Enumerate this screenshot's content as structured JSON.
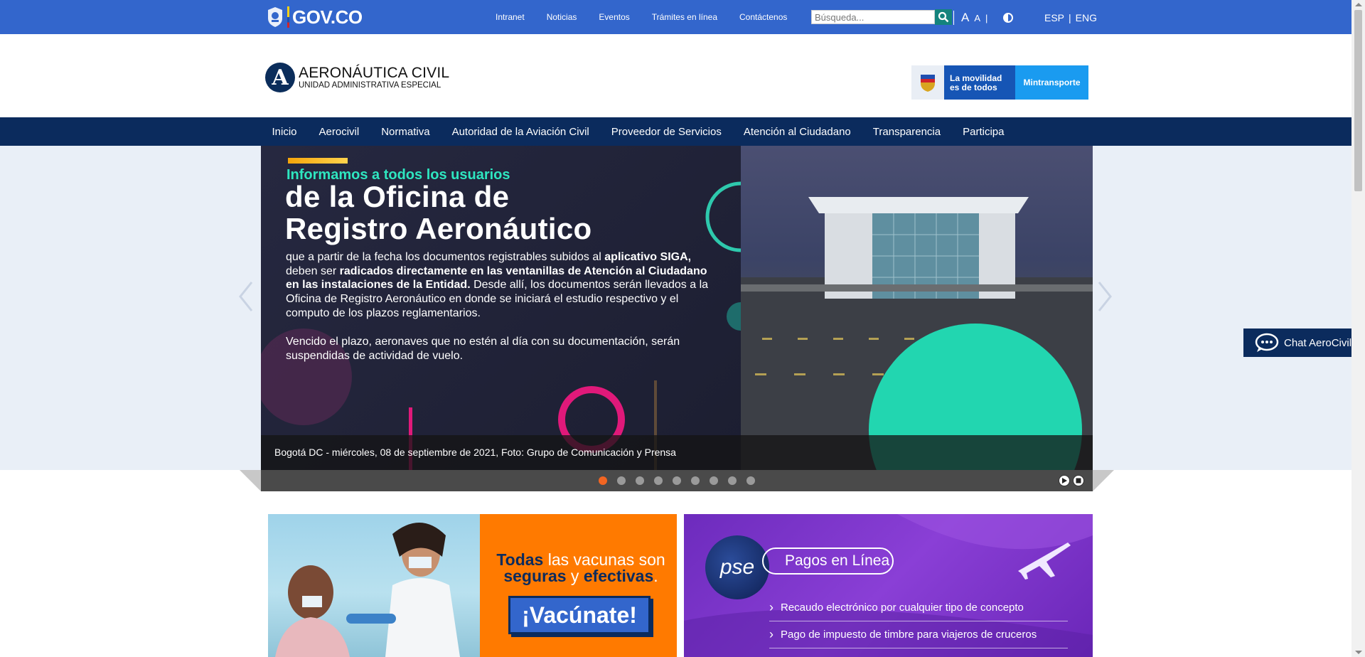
{
  "govbar": {
    "logo_text": "GOV.CO",
    "links": [
      "Intranet",
      "Noticias",
      "Eventos",
      "Trámites en línea",
      "Contáctenos"
    ],
    "search_placeholder": "Búsqueda...",
    "font_large": "A",
    "font_small": "A",
    "divider": "|",
    "lang_es": "ESP",
    "lang_sep": "|",
    "lang_en": "ENG"
  },
  "header": {
    "logo_letter": "A",
    "logo_line1": "AERONÁUTICA CIVIL",
    "logo_line2": "UNIDAD ADMINISTRATIVA ESPECIAL",
    "partner_line1": "La movilidad",
    "partner_line2": "es de todos",
    "partner_name": "Mintransporte"
  },
  "mainnav": {
    "items": [
      "Inicio",
      "Aerocivil",
      "Normativa",
      "Autoridad de la Aviación Civil",
      "Proveedor de Servicios",
      "Atención al Ciudadano",
      "Transparencia",
      "Participa"
    ]
  },
  "slider": {
    "kicker": "Informamos a todos los usuarios",
    "headline_1": "de la Oficina de",
    "headline_2": "Registro Aeronáutico",
    "para1_a": "que a partir de la fecha los documentos registrables subidos al ",
    "para1_b": "aplicativo SIGA,",
    "para1_c": " deben ser ",
    "para1_d": "radicados directamente en las ventanillas de Atención al Ciudadano en las instalaciones de la Entidad.",
    "para1_e": " Desde allí, los documentos serán llevados a la Oficina de Registro Aeronáutico en donde se iniciará el estudio respectivo y el computo de los plazos reglamentarios.",
    "para2": "Vencido el plazo, aeronaves que no estén al día con su documentación, serán suspendidas de actividad de vuelo.",
    "caption": "Bogotá DC - miércoles, 08 de septiembre de 2021, Foto: Grupo de Comunicación y Prensa",
    "dot_count": 9,
    "active_dot": 0
  },
  "chat": {
    "label": "Chat AeroCivil"
  },
  "banner_vacunas": {
    "word1": "Todas",
    "word2": " las vacunas son ",
    "word3": "seguras",
    "word4": " y ",
    "word5": "efectivas",
    "word6": ".",
    "cta": "¡Vacúnate!"
  },
  "banner_pse": {
    "logo": "pse",
    "title": "Pagos en Línea",
    "item1": "Recaudo electrónico por cualquier tipo de concepto",
    "item2": "Pago de impuesto de timbre para viajeros de cruceros"
  },
  "colors": {
    "govbar": "#3366cc",
    "nav": "#0b2b5d",
    "accent_dot": "#f26522"
  }
}
